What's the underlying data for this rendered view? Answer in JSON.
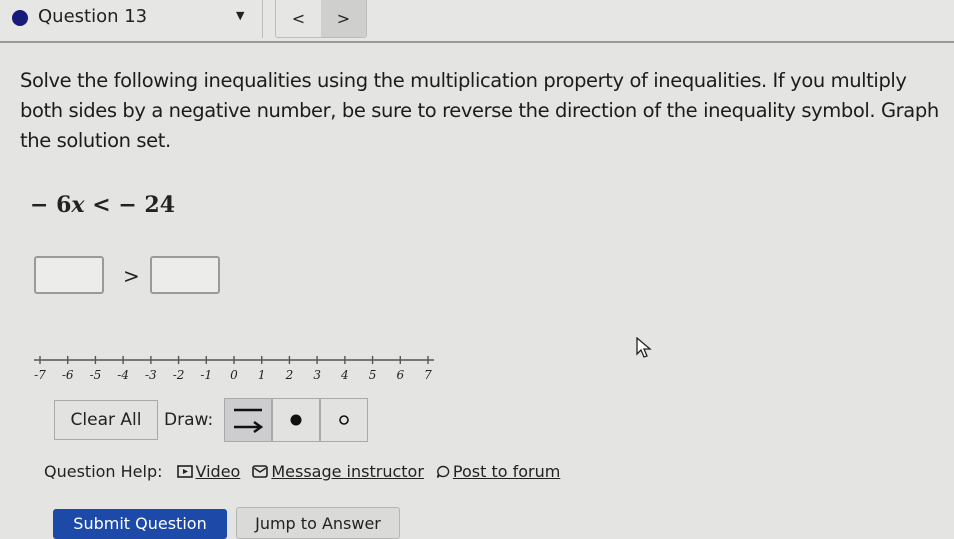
{
  "header": {
    "title": "Question 13",
    "dropdown_icon": "caret-down-icon",
    "prev_label": "<",
    "next_label": ">"
  },
  "prompt": {
    "text": "Solve the following inequalities using the multiplication property of inequalities. If you multiply both sides by a negative number, be sure to reverse the direction of the inequality symbol. Graph the solution set."
  },
  "inequality": {
    "coef": "− 6",
    "variable": "x",
    "op": "<",
    "rhs": "− 24"
  },
  "answer": {
    "left_value": "",
    "operator": ">",
    "right_value": ""
  },
  "number_line": {
    "min": -7,
    "max": 7,
    "ticks": [
      "-7",
      "-6",
      "-5",
      "-4",
      "-3",
      "-2",
      "-1",
      "0",
      "1",
      "2",
      "3",
      "4",
      "5",
      "6",
      "7"
    ]
  },
  "graph_tools": {
    "clear_label": "Clear All",
    "draw_label": "Draw:",
    "tools": [
      {
        "name": "ray-tool",
        "icon": "ray-arrow-icon",
        "selected": true
      },
      {
        "name": "closed-dot-tool",
        "icon": "filled-dot-icon",
        "selected": false
      },
      {
        "name": "open-dot-tool",
        "icon": "open-dot-icon",
        "selected": false
      }
    ]
  },
  "help": {
    "label": "Question Help:",
    "links": [
      {
        "label": "Video",
        "icon": "video-icon"
      },
      {
        "label": "Message instructor",
        "icon": "mail-icon"
      },
      {
        "label": "Post to forum",
        "icon": "forum-icon"
      }
    ]
  },
  "actions": {
    "submit_label": "Submit Question",
    "jump_label": "Jump to Answer"
  },
  "colors": {
    "primary": "#1d4aa8",
    "status_dot": "#1a1a7a"
  }
}
